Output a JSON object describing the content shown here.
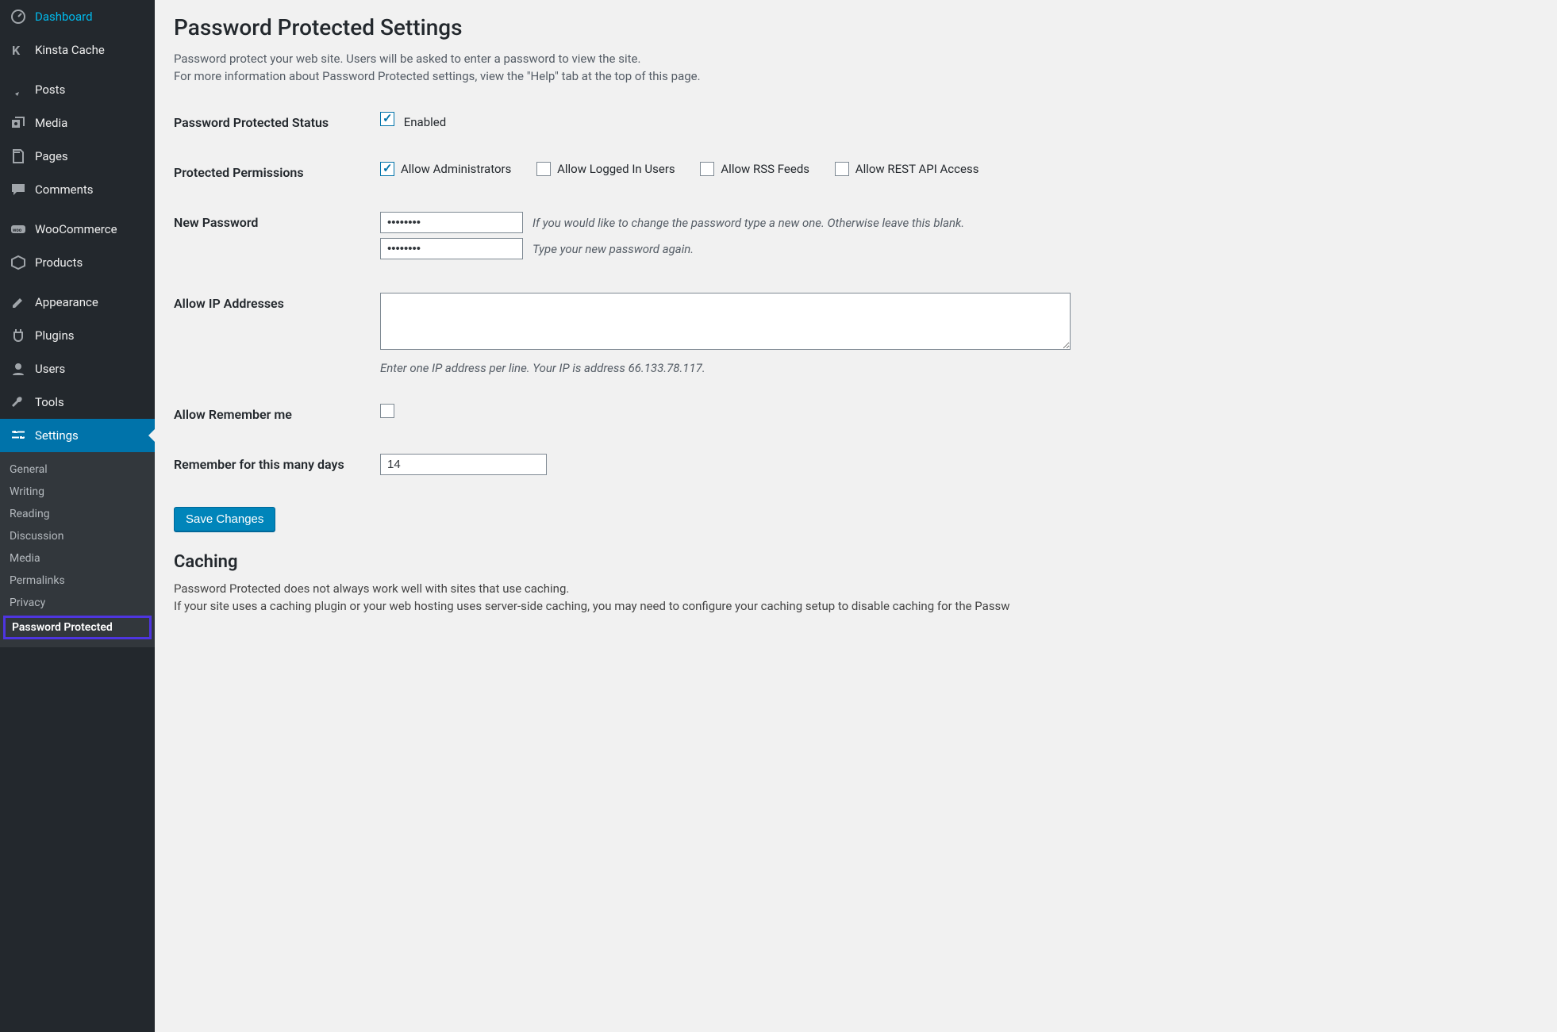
{
  "sidebar": {
    "items": [
      {
        "label": "Dashboard",
        "icon": "dashboard"
      },
      {
        "label": "Kinsta Cache",
        "icon": "kinsta"
      },
      {
        "label": "Posts",
        "icon": "pin"
      },
      {
        "label": "Media",
        "icon": "media"
      },
      {
        "label": "Pages",
        "icon": "pages"
      },
      {
        "label": "Comments",
        "icon": "comment"
      },
      {
        "label": "WooCommerce",
        "icon": "woo"
      },
      {
        "label": "Products",
        "icon": "products"
      },
      {
        "label": "Appearance",
        "icon": "appearance"
      },
      {
        "label": "Plugins",
        "icon": "plugins"
      },
      {
        "label": "Users",
        "icon": "users"
      },
      {
        "label": "Tools",
        "icon": "tools"
      },
      {
        "label": "Settings",
        "icon": "settings"
      }
    ],
    "settings_sub": [
      "General",
      "Writing",
      "Reading",
      "Discussion",
      "Media",
      "Permalinks",
      "Privacy",
      "Password Protected"
    ]
  },
  "page": {
    "title": "Password Protected Settings",
    "desc1": "Password protect your web site. Users will be asked to enter a password to view the site.",
    "desc2": "For more information about Password Protected settings, view the \"Help\" tab at the top of this page.",
    "status_label": "Password Protected Status",
    "enabled_label": "Enabled",
    "perm_label": "Protected Permissions",
    "perm_admins": "Allow Administrators",
    "perm_logged": "Allow Logged In Users",
    "perm_rss": "Allow RSS Feeds",
    "perm_rest": "Allow REST API Access",
    "newpw_label": "New Password",
    "pw1_value": "••••••••",
    "pw1_desc": "If you would like to change the password type a new one. Otherwise leave this blank.",
    "pw2_value": "••••••••",
    "pw2_desc": "Type your new password again.",
    "ip_label": "Allow IP Addresses",
    "ip_desc": "Enter one IP address per line. Your IP is address 66.133.78.117.",
    "remember_label": "Allow Remember me",
    "remember_days_label": "Remember for this many days",
    "remember_days_value": "14",
    "save_label": "Save Changes",
    "caching_heading": "Caching",
    "caching_p1": "Password Protected does not always work well with sites that use caching.",
    "caching_p2": "If your site uses a caching plugin or your web hosting uses server-side caching, you may need to configure your caching setup to disable caching for the Passw"
  }
}
